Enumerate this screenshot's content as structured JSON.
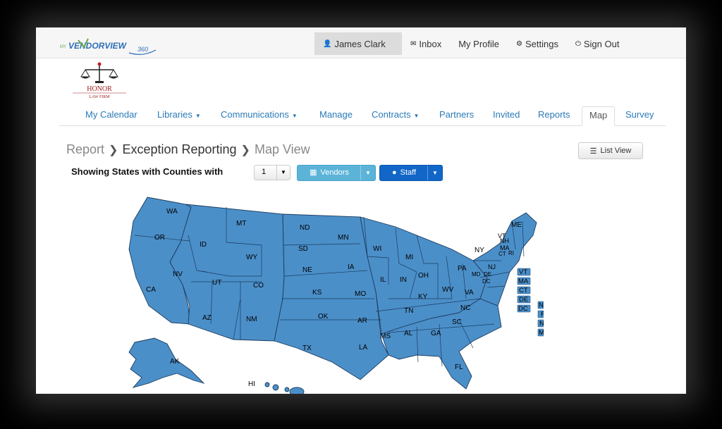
{
  "brand": {
    "logo_text": "MyVendorView360"
  },
  "topnav": [
    {
      "label": "James Clark",
      "icon": "user-icon"
    },
    {
      "label": "Inbox",
      "icon": "envelope-icon"
    },
    {
      "label": "My Profile",
      "icon": ""
    },
    {
      "label": "Settings",
      "icon": "gear-icon"
    },
    {
      "label": "Sign Out",
      "icon": "power-icon"
    }
  ],
  "firm": {
    "name": "HONOR",
    "subtitle": "LAW FIRM"
  },
  "mainnav": [
    {
      "label": "My Calendar"
    },
    {
      "label": "Libraries",
      "dropdown": true
    },
    {
      "label": "Communications",
      "dropdown": true
    },
    {
      "label": "Manage"
    },
    {
      "label": "Contracts",
      "dropdown": true
    },
    {
      "label": "Partners"
    },
    {
      "label": "Invited"
    },
    {
      "label": "Reports"
    },
    {
      "label": "Map",
      "active": true
    },
    {
      "label": "Survey"
    }
  ],
  "breadcrumb": {
    "first": "Report",
    "current": "Exception Reporting",
    "last": "Map View"
  },
  "list_view_label": "List View",
  "filter": {
    "label": "Showing States with Counties with",
    "count_value": "1",
    "vendors_label": "Vendors",
    "staff_label": "Staff"
  },
  "map": {
    "fill_color": "#4b8fc9",
    "states": [
      "WA",
      "OR",
      "CA",
      "ID",
      "NV",
      "MT",
      "WY",
      "UT",
      "AZ",
      "CO",
      "NM",
      "ND",
      "SD",
      "NE",
      "KS",
      "OK",
      "TX",
      "MN",
      "IA",
      "MO",
      "AR",
      "LA",
      "WI",
      "IL",
      "MI",
      "IN",
      "OH",
      "KY",
      "TN",
      "MS",
      "AL",
      "GA",
      "FL",
      "SC",
      "NC",
      "VA",
      "WV",
      "PA",
      "NY",
      "ME",
      "VT",
      "NH",
      "MA",
      "CT",
      "RI",
      "NJ",
      "DE",
      "MD",
      "DC",
      "AK",
      "HI"
    ],
    "small_state_boxes": {
      "left": [
        "NH",
        "RI",
        "NJ",
        "MD"
      ],
      "right": [
        "VT",
        "MA",
        "CT",
        "DE",
        "DC"
      ]
    }
  }
}
